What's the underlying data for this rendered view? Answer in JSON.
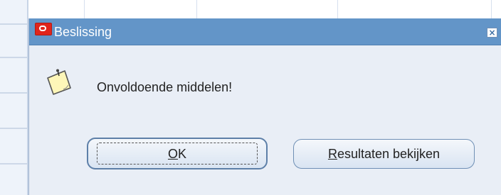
{
  "dialog": {
    "title": "Beslissing",
    "close_glyph": "×",
    "icon": "note-icon",
    "message": "Onvoldoende middelen!",
    "buttons": [
      {
        "mnemonic": "O",
        "rest": "K",
        "full_label": "OK"
      },
      {
        "mnemonic": "R",
        "rest": "esultaten bekijken",
        "full_label": "Resultaten bekijken"
      }
    ]
  },
  "colors": {
    "titlebar": "#6395c8",
    "dialog_background": "#e9eef6",
    "button_border": "#6f8fb5",
    "logo_red": "#e0241b"
  }
}
